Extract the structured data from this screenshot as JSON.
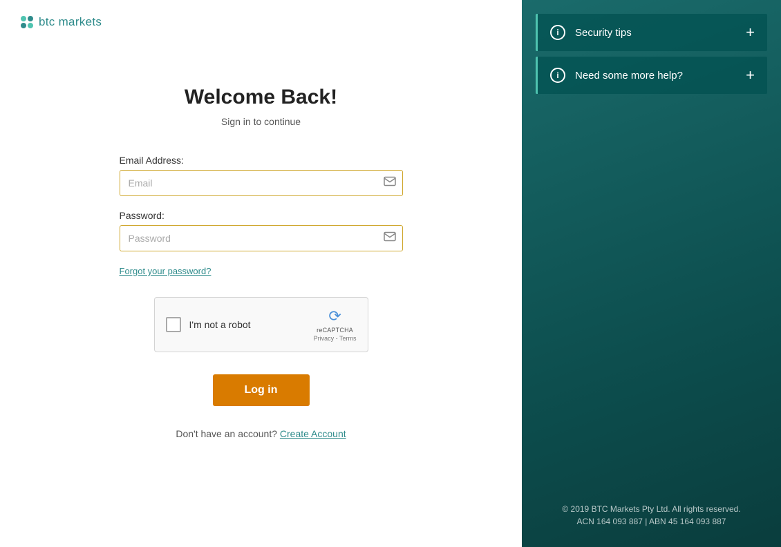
{
  "logo": {
    "brand": "btc markets",
    "alt": "BTC Markets logo"
  },
  "left": {
    "title": "Welcome Back!",
    "subtitle": "Sign in to continue",
    "email_label": "Email Address:",
    "email_placeholder": "Email",
    "password_label": "Password:",
    "password_placeholder": "Password",
    "forgot_password": "Forgot your password?",
    "recaptcha_label": "I'm not a robot",
    "recaptcha_brand": "reCAPTCHA",
    "recaptcha_links": "Privacy - Terms",
    "login_button": "Log in",
    "no_account_text": "Don't have an account?",
    "create_account_link": "Create Account"
  },
  "right": {
    "accordion_items": [
      {
        "label": "Security tips",
        "icon": "i",
        "expanded": false
      },
      {
        "label": "Need some more help?",
        "icon": "i",
        "expanded": false
      }
    ],
    "footer_line1": "© 2019 BTC Markets Pty Ltd. All rights reserved.",
    "footer_line2": "ACN 164 093 887 | ABN 45 164 093 887"
  }
}
